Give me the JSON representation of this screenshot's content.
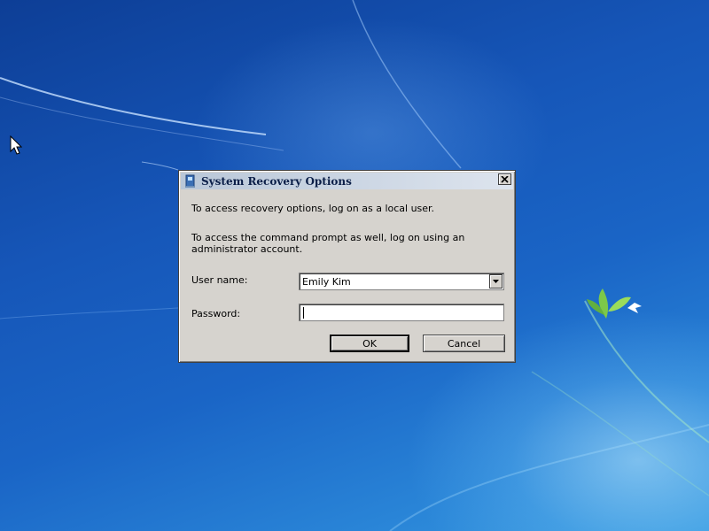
{
  "dialog": {
    "title": "System Recovery Options",
    "message_local_user": "To access recovery options, log on as a local user.",
    "message_admin": "To access the command prompt as well, log on using an administrator account.",
    "username_label": "User name:",
    "username_value": "Emily Kim",
    "password_label": "Password:",
    "password_value": "",
    "ok_label": "OK",
    "cancel_label": "Cancel"
  },
  "icons": {
    "title": "recovery-computer-icon",
    "close": "close-icon",
    "dropdown": "chevron-down-icon",
    "cursor": "mouse-pointer-icon"
  },
  "colors": {
    "dialog_face": "#d6d3ce",
    "title_text": "#0b1f48",
    "desktop": "#1656b8"
  }
}
